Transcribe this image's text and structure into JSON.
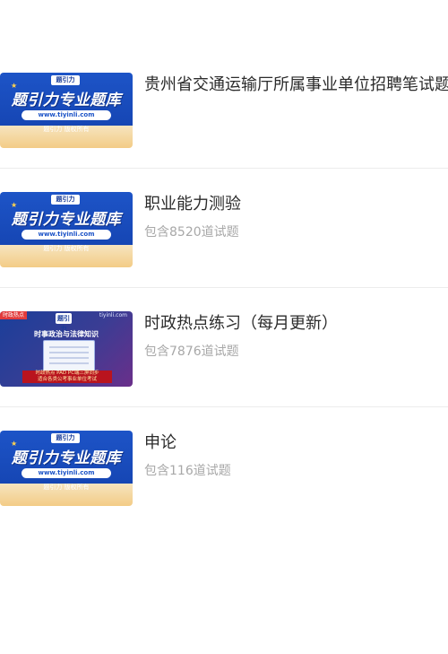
{
  "items": [
    {
      "title": "贵州省交通运输厅所属事业单位招聘笔试题库",
      "subtitle": "",
      "thumb": {
        "type": "brand",
        "logo": "题引力",
        "headline": "题引力专业题库",
        "url": "www.tiyinli.com",
        "tag": "题引力 版权所有"
      }
    },
    {
      "title": "职业能力测验",
      "subtitle": "包含8520道试题",
      "thumb": {
        "type": "brand",
        "logo": "题引力",
        "headline": "题引力专业题库",
        "url": "www.tiyinli.com",
        "tag": "题引力 版权所有"
      }
    },
    {
      "title": "时政热点练习（每月更新）",
      "subtitle": "包含7876道试题",
      "thumb": {
        "type": "affairs",
        "flag": "时政热点",
        "site": "tiyinli.com",
        "logo": "题引力",
        "headline": "时事政治与法律知识",
        "bar1": "时政热点 PAD PC端三屏同步",
        "bar2": "适合各类公考事业单位考试"
      }
    },
    {
      "title": "申论",
      "subtitle": "包含116道试题",
      "thumb": {
        "type": "brand",
        "logo": "题引力",
        "headline": "题引力专业题库",
        "url": "www.tiyinli.com",
        "tag": "题引力 版权所有"
      }
    }
  ]
}
